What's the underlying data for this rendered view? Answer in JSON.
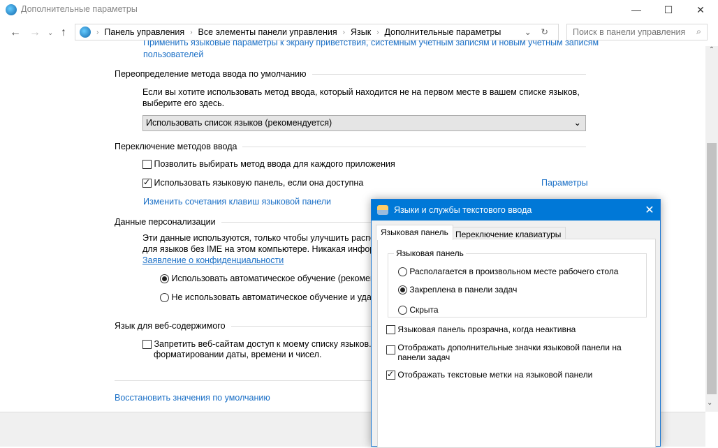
{
  "window": {
    "title": "Дополнительные параметры",
    "minimize": "—",
    "maximize": "☐",
    "close": "✕"
  },
  "address": {
    "crumbs": [
      "Панель управления",
      "Все элементы панели управления",
      "Язык",
      "Дополнительные параметры"
    ],
    "search_placeholder": "Поиск в панели управления"
  },
  "top_link": {
    "line1": "Применить языковые параметры к экрану приветствия, системным учетным записям и новым учетным записям",
    "line2": "пользователей"
  },
  "override": {
    "header": "Переопределение метода ввода по умолчанию",
    "desc1": "Если вы хотите использовать метод ввода, который находится не на первом месте в вашем списке языков,",
    "desc2": "выберите его здесь.",
    "select_value": "Использовать список языков (рекомендуется)"
  },
  "switching": {
    "header": "Переключение методов ввода",
    "cb1": "Позволить выбирать метод ввода для каждого приложения",
    "cb1_checked": false,
    "cb2": "Использовать языковую панель, если она доступна",
    "cb2_checked": true,
    "params_link": "Параметры",
    "hotkeys_link": "Изменить сочетания клавиш языковой панели"
  },
  "personal": {
    "header": "Данные персонализации",
    "desc1": "Эти данные используются, только чтобы улучшить распоз",
    "desc2": "для языков без IME на этом компьютере. Никакая информ",
    "privacy_link": "Заявление о конфиденциальности",
    "r1": "Использовать автоматическое обучение (рекоменд",
    "r2": "Не использовать автоматическое обучение и удали"
  },
  "web": {
    "header": "Язык для веб-содержимого",
    "cb1": "Запретить веб-сайтам доступ к моему списку языков. Бу",
    "cb1b": "форматировании даты, времени и чисел."
  },
  "restore_link": "Восстановить значения по умолчанию",
  "dialog": {
    "title": "Языки и службы текстового ввода",
    "tabs": [
      "Языковая панель",
      "Переключение клавиатуры"
    ],
    "group": "Языковая панель",
    "radios": [
      "Располагается в произвольном месте рабочего стола",
      "Закреплена в панели задач",
      "Скрыта"
    ],
    "selected_radio": 1,
    "cb1": "Языковая панель прозрачна, когда неактивна",
    "cb2a": "Отображать дополнительные значки языковой панели на",
    "cb2b": "панели задач",
    "cb3": "Отображать текстовые метки на языковой панели"
  }
}
